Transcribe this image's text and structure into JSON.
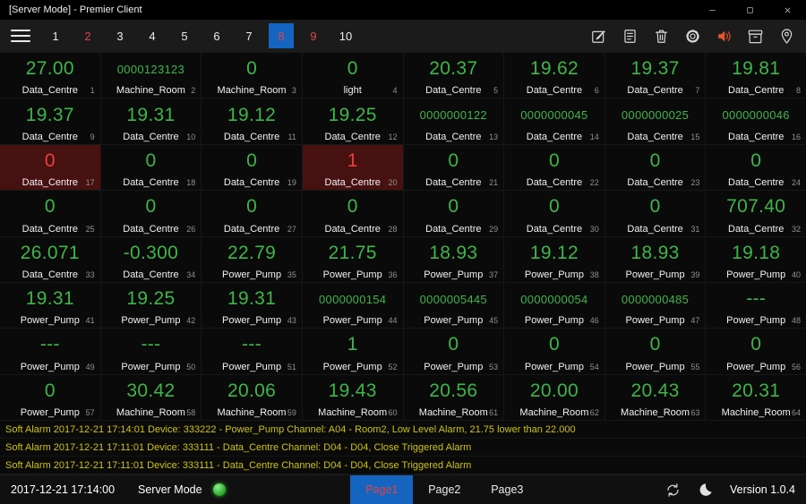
{
  "window": {
    "title": "[Server Mode] - Premier Client",
    "controls": [
      {
        "name": "minimize-icon"
      },
      {
        "name": "maximize-icon"
      },
      {
        "name": "close-icon"
      }
    ]
  },
  "toolbar": {
    "pages": [
      {
        "label": "1"
      },
      {
        "label": "2",
        "alarm": true
      },
      {
        "label": "3"
      },
      {
        "label": "4"
      },
      {
        "label": "5"
      },
      {
        "label": "6"
      },
      {
        "label": "7"
      },
      {
        "label": "8",
        "alarm": true,
        "selected": true
      },
      {
        "label": "9",
        "alarm": true
      },
      {
        "label": "10"
      }
    ],
    "icons": [
      {
        "name": "edit-icon"
      },
      {
        "name": "note-icon"
      },
      {
        "name": "trash-icon"
      },
      {
        "name": "settings-icon"
      },
      {
        "name": "speaker-icon",
        "color": "#e0562b"
      },
      {
        "name": "archive-icon"
      },
      {
        "name": "location-icon"
      }
    ]
  },
  "grid": {
    "cells": [
      {
        "value": "27.00",
        "label": "Data_Centre",
        "index": 1
      },
      {
        "value": "0000123123",
        "label": "Machine_Room",
        "index": 2
      },
      {
        "value": "0",
        "label": "Machine_Room",
        "index": 3
      },
      {
        "value": "0",
        "label": "light",
        "index": 4
      },
      {
        "value": "20.37",
        "label": "Data_Centre",
        "index": 5
      },
      {
        "value": "19.62",
        "label": "Data_Centre",
        "index": 6
      },
      {
        "value": "19.37",
        "label": "Data_Centre",
        "index": 7
      },
      {
        "value": "19.81",
        "label": "Data_Centre",
        "index": 8
      },
      {
        "value": "19.37",
        "label": "Data_Centre",
        "index": 9
      },
      {
        "value": "19.31",
        "label": "Data_Centre",
        "index": 10
      },
      {
        "value": "19.12",
        "label": "Data_Centre",
        "index": 11
      },
      {
        "value": "19.25",
        "label": "Data_Centre",
        "index": 12
      },
      {
        "value": "0000000122",
        "label": "Data_Centre",
        "index": 13
      },
      {
        "value": "0000000045",
        "label": "Data_Centre",
        "index": 14
      },
      {
        "value": "0000000025",
        "label": "Data_Centre",
        "index": 15
      },
      {
        "value": "0000000046",
        "label": "Data_Centre",
        "index": 16
      },
      {
        "value": "0",
        "label": "Data_Centre",
        "index": 17,
        "alarm": true
      },
      {
        "value": "0",
        "label": "Data_Centre",
        "index": 18
      },
      {
        "value": "0",
        "label": "Data_Centre",
        "index": 19
      },
      {
        "value": "1",
        "label": "Data_Centre",
        "index": 20,
        "alarm": true
      },
      {
        "value": "0",
        "label": "Data_Centre",
        "index": 21
      },
      {
        "value": "0",
        "label": "Data_Centre",
        "index": 22
      },
      {
        "value": "0",
        "label": "Data_Centre",
        "index": 23
      },
      {
        "value": "0",
        "label": "Data_Centre",
        "index": 24
      },
      {
        "value": "0",
        "label": "Data_Centre",
        "index": 25
      },
      {
        "value": "0",
        "label": "Data_Centre",
        "index": 26
      },
      {
        "value": "0",
        "label": "Data_Centre",
        "index": 27
      },
      {
        "value": "0",
        "label": "Data_Centre",
        "index": 28
      },
      {
        "value": "0",
        "label": "Data_Centre",
        "index": 29
      },
      {
        "value": "0",
        "label": "Data_Centre",
        "index": 30
      },
      {
        "value": "0",
        "label": "Data_Centre",
        "index": 31
      },
      {
        "value": "707.40",
        "label": "Data_Centre",
        "index": 32
      },
      {
        "value": "26.071",
        "label": "Data_Centre",
        "index": 33
      },
      {
        "value": "-0.300",
        "label": "Data_Centre",
        "index": 34
      },
      {
        "value": "22.79",
        "label": "Power_Pump",
        "index": 35
      },
      {
        "value": "21.75",
        "label": "Power_Pump",
        "index": 36
      },
      {
        "value": "18.93",
        "label": "Power_Pump",
        "index": 37
      },
      {
        "value": "19.12",
        "label": "Power_Pump",
        "index": 38
      },
      {
        "value": "18.93",
        "label": "Power_Pump",
        "index": 39
      },
      {
        "value": "19.18",
        "label": "Power_Pump",
        "index": 40
      },
      {
        "value": "19.31",
        "label": "Power_Pump",
        "index": 41
      },
      {
        "value": "19.25",
        "label": "Power_Pump",
        "index": 42
      },
      {
        "value": "19.31",
        "label": "Power_Pump",
        "index": 43
      },
      {
        "value": "0000000154",
        "label": "Power_Pump",
        "index": 44
      },
      {
        "value": "0000005445",
        "label": "Power_Pump",
        "index": 45
      },
      {
        "value": "0000000054",
        "label": "Power_Pump",
        "index": 46
      },
      {
        "value": "0000000485",
        "label": "Power_Pump",
        "index": 47
      },
      {
        "value": "---",
        "label": "Power_Pump",
        "index": 48
      },
      {
        "value": "---",
        "label": "Power_Pump",
        "index": 49
      },
      {
        "value": "---",
        "label": "Power_Pump",
        "index": 50
      },
      {
        "value": "---",
        "label": "Power_Pump",
        "index": 51
      },
      {
        "value": "1",
        "label": "Power_Pump",
        "index": 52
      },
      {
        "value": "0",
        "label": "Power_Pump",
        "index": 53
      },
      {
        "value": "0",
        "label": "Power_Pump",
        "index": 54
      },
      {
        "value": "0",
        "label": "Power_Pump",
        "index": 55
      },
      {
        "value": "0",
        "label": "Power_Pump",
        "index": 56
      },
      {
        "value": "0",
        "label": "Power_Pump",
        "index": 57
      },
      {
        "value": "30.42",
        "label": "Machine_Room",
        "index": 58
      },
      {
        "value": "20.06",
        "label": "Machine_Room",
        "index": 59
      },
      {
        "value": "19.43",
        "label": "Machine_Room",
        "index": 60
      },
      {
        "value": "20.56",
        "label": "Machine_Room",
        "index": 61
      },
      {
        "value": "20.00",
        "label": "Machine_Room",
        "index": 62
      },
      {
        "value": "20.43",
        "label": "Machine_Room",
        "index": 63
      },
      {
        "value": "20.31",
        "label": "Machine_Room",
        "index": 64
      }
    ]
  },
  "alarms": [
    {
      "text": "Soft Alarm 2017-12-21 17:14:01 Device: 333222 - Power_Pump Channel: A04 - Room2, Low Level Alarm, 21.75 lower than 22.000"
    },
    {
      "text": "Soft Alarm 2017-12-21 17:11:01 Device: 333111 - Data_Centre Channel: D04 - D04, Close Triggered Alarm"
    },
    {
      "text": "Soft Alarm 2017-12-21 17:11:01 Device: 333111 - Data_Centre Channel: D04 - D04, Close Triggered Alarm"
    }
  ],
  "statusbar": {
    "timestamp": "2017-12-21 17:14:00",
    "mode_label": "Server Mode",
    "tabs": [
      {
        "label": "Page1",
        "active": true
      },
      {
        "label": "Page2"
      },
      {
        "label": "Page3"
      }
    ],
    "icons": [
      {
        "name": "sync-icon"
      },
      {
        "name": "moon-icon"
      }
    ],
    "version": "Version 1.0.4"
  },
  "colors": {
    "green": "#3db549",
    "value-red": "#ee3d3d",
    "cell-alarm-bg": "#481111",
    "yellow": "#cfc400",
    "blue": "#1565c0",
    "page-red": "#e04545",
    "indicator-green": "#28a428"
  }
}
